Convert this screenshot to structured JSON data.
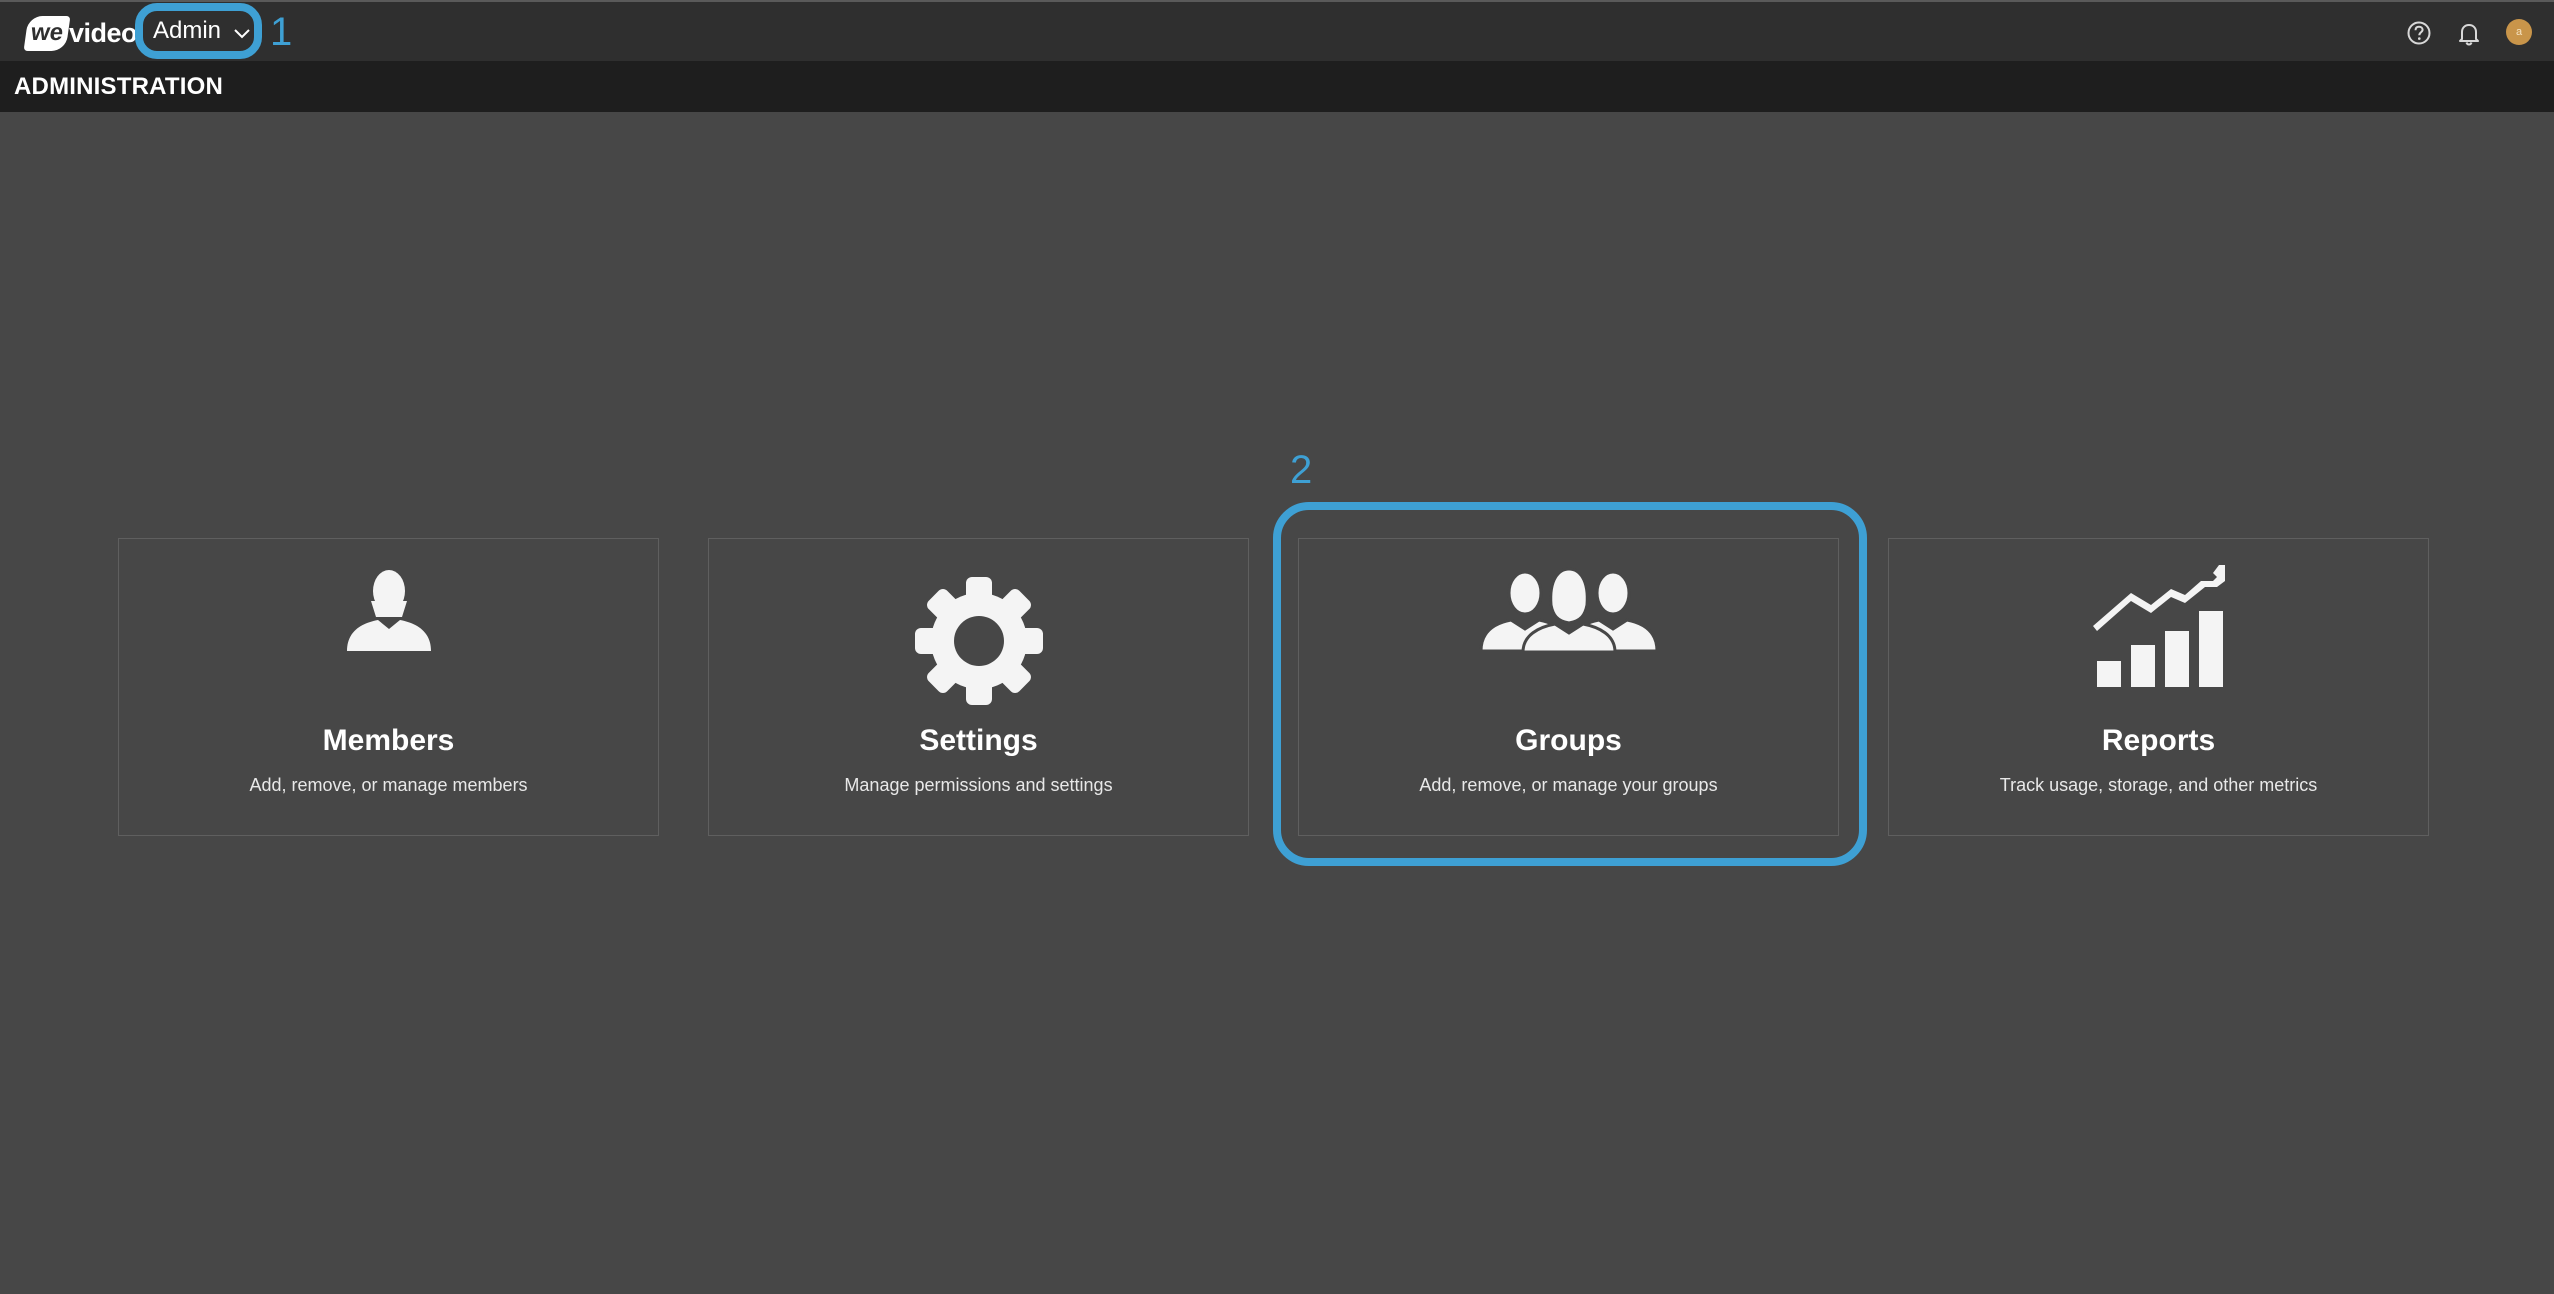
{
  "app": {
    "logo_we": "we",
    "logo_video": "video",
    "switcher_label": "Admin"
  },
  "header": {
    "icons": [
      "help-icon",
      "bell-icon",
      "avatar"
    ],
    "avatar_initial": "a"
  },
  "page": {
    "title": "ADMINISTRATION"
  },
  "annotations": {
    "marker_1": "1",
    "marker_2": "2",
    "accent_color": "#3ea0d4"
  },
  "cards": [
    {
      "title": "Members",
      "description": "Add, remove, or manage members",
      "icon": "person-icon"
    },
    {
      "title": "Settings",
      "description": "Manage permissions and settings",
      "icon": "gear-icon"
    },
    {
      "title": "Groups",
      "description": "Add, remove, or manage your groups",
      "icon": "group-icon"
    },
    {
      "title": "Reports",
      "description": "Track usage, storage, and other metrics",
      "icon": "chart-icon"
    }
  ]
}
